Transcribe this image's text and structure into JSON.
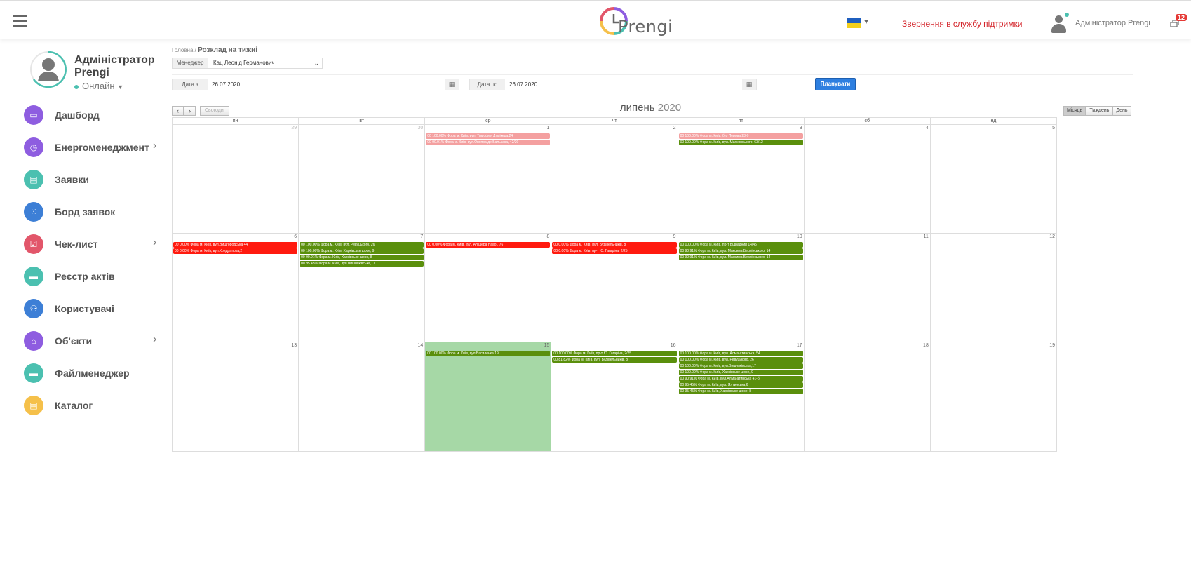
{
  "header": {
    "logo_text": "Prengi",
    "support_link": "Звернення в службу підтримки",
    "user_name": "Адміністратор Prengi",
    "notifications_count": "12"
  },
  "profile": {
    "name_line1": "Адміністратор",
    "name_line2": "Prengi",
    "status": "Онлайн"
  },
  "nav": [
    {
      "label": "Дашборд",
      "color": "#8e5de0",
      "icon": "monitor-icon",
      "arrow": false
    },
    {
      "label": "Енергоменеджмент",
      "color": "#8e5de0",
      "icon": "clock-icon",
      "arrow": true
    },
    {
      "label": "Заявки",
      "color": "#4bc0b0",
      "icon": "document-icon",
      "arrow": false
    },
    {
      "label": "Борд заявок",
      "color": "#3d7fd6",
      "icon": "grid-icon",
      "arrow": false
    },
    {
      "label": "Чек-лист",
      "color": "#e2566a",
      "icon": "checkbox-icon",
      "arrow": true
    },
    {
      "label": "Реєстр актів",
      "color": "#4bc0b0",
      "icon": "folder-icon",
      "arrow": false
    },
    {
      "label": "Користувачі",
      "color": "#3d7fd6",
      "icon": "users-icon",
      "arrow": false
    },
    {
      "label": "Об'єкти",
      "color": "#8e5de0",
      "icon": "home-icon",
      "arrow": true
    },
    {
      "label": "Файлменеджер",
      "color": "#4bc0b0",
      "icon": "folder-icon",
      "arrow": false
    },
    {
      "label": "Каталог",
      "color": "#f5c04a",
      "icon": "document-icon",
      "arrow": false
    }
  ],
  "breadcrumb": {
    "home": "Головна",
    "separator": "/",
    "current": "Розклад на тижні"
  },
  "filters": {
    "manager_label": "Менеджер",
    "manager_value": "Кац Леонід Германович",
    "date_from_label": "Дата з",
    "date_from_value": "26.07.2020",
    "date_to_label": "Дата по",
    "date_to_value": "26.07.2020",
    "plan_button": "Планувати"
  },
  "calendar": {
    "prev": "‹",
    "next": "›",
    "today": "Сьогодні",
    "month": "липень",
    "year": "2020",
    "views": [
      "Місяць",
      "Тиждень",
      "День"
    ],
    "weekdays": [
      "пн",
      "вт",
      "ср",
      "чт",
      "пт",
      "сб",
      "нд"
    ],
    "weeks": [
      [
        {
          "num": "29",
          "other": true,
          "events": []
        },
        {
          "num": "30",
          "other": true,
          "events": []
        },
        {
          "num": "1",
          "events": [
            {
              "text": "00 100.00% Фора м. Київ, вул. Тимофея Думікера,24",
              "color": "pink"
            },
            {
              "text": "00 90.91% Фора м. Київ, вул.Онопра де Бальзака, 42/20",
              "color": "pink"
            }
          ]
        },
        {
          "num": "2",
          "events": []
        },
        {
          "num": "3",
          "events": [
            {
              "text": "00 100.00% Фора м. Київ, б-р Перова,23-б",
              "color": "pink"
            },
            {
              "text": "00 100.00% Фора м. Київ, вул. Маяковського, 63/12",
              "color": "green"
            }
          ]
        },
        {
          "num": "4",
          "events": []
        },
        {
          "num": "5",
          "events": []
        }
      ],
      [
        {
          "num": "6",
          "events": [
            {
              "text": "00 0.00% Фора м. Київ, вул.Вишгородська 44",
              "color": "red"
            },
            {
              "text": "00 0.00% Фора м. Київ, вул.Кондратюка,2",
              "color": "red"
            }
          ]
        },
        {
          "num": "7",
          "events": [
            {
              "text": "00 100.00% Фора м. Київ, вул. Ревуцького, 26",
              "color": "green"
            },
            {
              "text": "00 100.00% Фора м. Київ, Харківське шосе, 9",
              "color": "green"
            },
            {
              "text": "00 90.91% Фора м. Київ, Харківське шосе, 8",
              "color": "green"
            },
            {
              "text": "00 95.45% Фора м. Київ, вул.Вишняківська,17",
              "color": "green"
            }
          ]
        },
        {
          "num": "8",
          "events": [
            {
              "text": "00 0.00% Фора м. Київ, вул. Алішера Навої, 76",
              "color": "red"
            }
          ]
        },
        {
          "num": "9",
          "events": [
            {
              "text": "00 0.00% Фора м. Київ, вул. Будівельників, 8",
              "color": "red"
            },
            {
              "text": "00 0.00% Фора м. Київ, пр-т Ю. Гагаріна, 2/25",
              "color": "red"
            }
          ]
        },
        {
          "num": "10",
          "events": [
            {
              "text": "00 100.00% Фора м. Київ, пр-т Відрадний 14/45",
              "color": "green"
            },
            {
              "text": "00 90.91% Фора м. Київ, вул. Максима Берлінського, 14",
              "color": "green"
            },
            {
              "text": "00 90.91% Фора м. Київ, вул. Максима Берлінського, 14",
              "color": "green"
            }
          ]
        },
        {
          "num": "11",
          "events": []
        },
        {
          "num": "12",
          "events": []
        }
      ],
      [
        {
          "num": "13",
          "events": []
        },
        {
          "num": "14",
          "events": []
        },
        {
          "num": "15",
          "today": true,
          "events": [
            {
              "text": "00 100.00% Фора м. Київ, вул.Василенка,19",
              "color": "green"
            }
          ]
        },
        {
          "num": "16",
          "events": [
            {
              "text": "00 100.00% Фора м. Київ, пр-т Ю. Гагаріна, 2/25",
              "color": "green"
            },
            {
              "text": "00 81.82% Фора м. Київ, вул. Будівельників, 8",
              "color": "green"
            }
          ]
        },
        {
          "num": "17",
          "events": [
            {
              "text": "00 100.00% Фора м. Київ, вул. Алма-атинська, 54",
              "color": "green"
            },
            {
              "text": "00 100.00% Фора м. Київ, вул. Ревуцького, 26",
              "color": "green"
            },
            {
              "text": "00 100.00% Фора м. Київ, вул.Вишняківська,17",
              "color": "green"
            },
            {
              "text": "00 100.00% Фора м. Київ, Харківське шосе, 9",
              "color": "green"
            },
            {
              "text": "00 90.91% Фора м. Київ, вул.Алма-атинська 41-б",
              "color": "green"
            },
            {
              "text": "00 95.45% Фора м. Київ, вул. Ялтинська,6",
              "color": "green"
            },
            {
              "text": "00 95.45% Фора м. Київ, Харківське шосе, 8",
              "color": "green"
            }
          ]
        },
        {
          "num": "18",
          "events": []
        },
        {
          "num": "19",
          "events": []
        }
      ]
    ]
  }
}
